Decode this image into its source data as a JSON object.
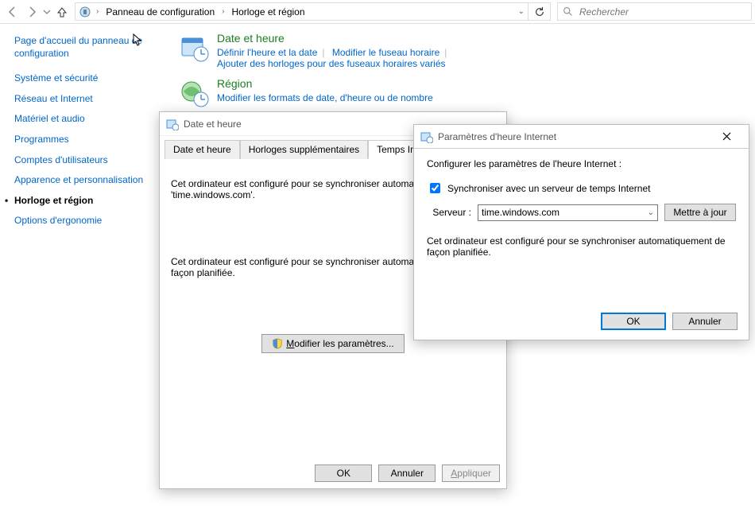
{
  "topbar": {
    "breadcrumb1": "Panneau de configuration",
    "breadcrumb2": "Horloge et région",
    "search_placeholder": "Rechercher"
  },
  "sidebar": {
    "home": "Page d'accueil du panneau de configuration",
    "items": [
      "Système et sécurité",
      "Réseau et Internet",
      "Matériel et audio",
      "Programmes",
      "Comptes d'utilisateurs",
      "Apparence et personnalisation",
      "Horloge et région",
      "Options d'ergonomie"
    ]
  },
  "main": {
    "date_time": {
      "title": "Date et heure",
      "link1": "Définir l'heure et la date",
      "link2": "Modifier le fuseau horaire",
      "link3": "Ajouter des horloges pour des fuseaux horaires variés"
    },
    "region": {
      "title": "Région",
      "link1": "Modifier les formats de date, d'heure ou de nombre"
    }
  },
  "dlg1": {
    "title": "Date et heure",
    "tabs": [
      "Date et heure",
      "Horloges supplémentaires",
      "Temps Internet"
    ],
    "body1": "Cet ordinateur est configuré pour se synchroniser automatiquement avec 'time.windows.com'.",
    "body2": "Cet ordinateur est configuré pour se synchroniser automatiquement de façon planifiée.",
    "modify_btn": "Modifier les paramètres...",
    "ok": "OK",
    "cancel": "Annuler",
    "apply": "Appliquer"
  },
  "dlg2": {
    "title": "Paramètres d'heure Internet",
    "intro": "Configurer les paramètres de l'heure Internet :",
    "sync_chk": "Synchroniser avec un serveur de temps Internet",
    "server_label": "Serveur :",
    "server_value": "time.windows.com",
    "update_btn": "Mettre à jour",
    "body": "Cet ordinateur est configuré pour se synchroniser automatiquement de façon planifiée.",
    "ok": "OK",
    "cancel": "Annuler"
  }
}
